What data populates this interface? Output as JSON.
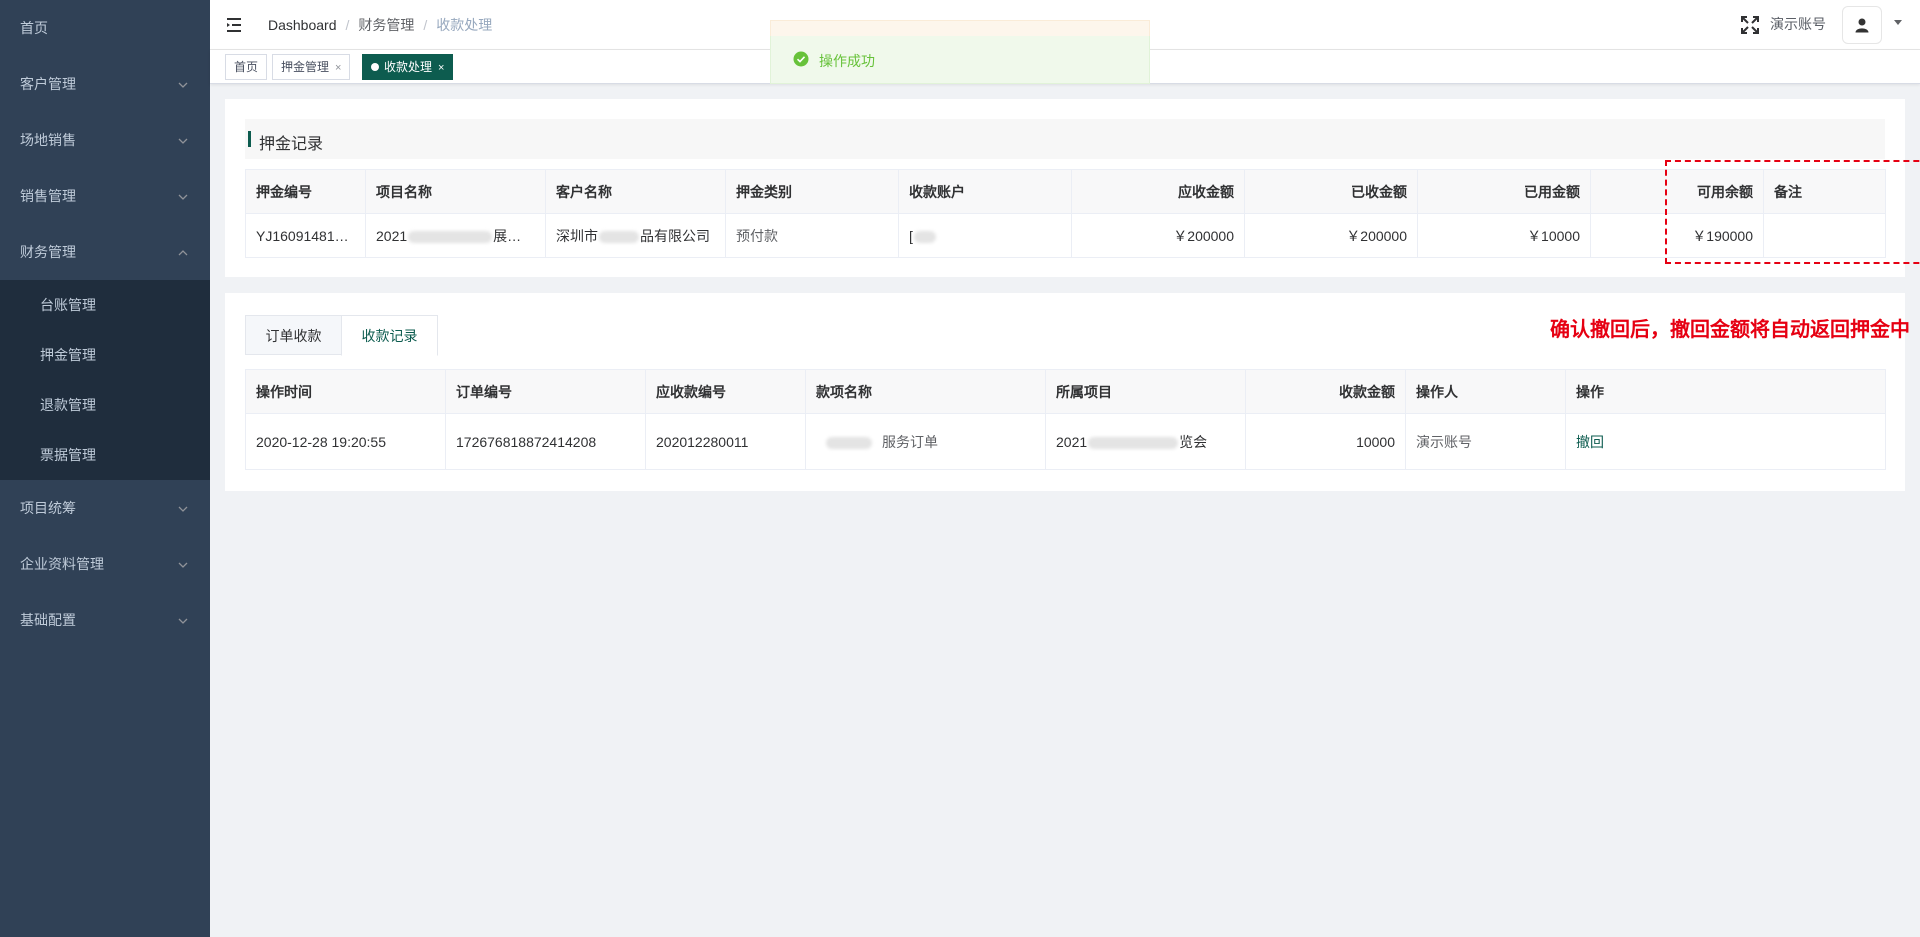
{
  "sidebar": {
    "items": [
      {
        "label": "首页",
        "has_children": false
      },
      {
        "label": "客户管理",
        "has_children": true
      },
      {
        "label": "场地销售",
        "has_children": true
      },
      {
        "label": "销售管理",
        "has_children": true
      },
      {
        "label": "财务管理",
        "has_children": true,
        "expanded": true
      }
    ],
    "finance_children": [
      "台账管理",
      "押金管理",
      "退款管理",
      "票据管理"
    ],
    "items_after": [
      {
        "label": "项目统筹"
      },
      {
        "label": "企业资料管理"
      },
      {
        "label": "基础配置"
      }
    ]
  },
  "navbar": {
    "breadcrumb": [
      "Dashboard",
      "财务管理",
      "收款处理"
    ],
    "username": "演示账号"
  },
  "tags": [
    {
      "label": "首页",
      "closable": false,
      "active": false
    },
    {
      "label": "押金管理",
      "closable": true,
      "active": false
    },
    {
      "label": "收款处理",
      "closable": true,
      "active": true
    }
  ],
  "toast": {
    "message": "操作成功"
  },
  "deposit": {
    "title": "押金记录",
    "headers": [
      "押金编号",
      "项目名称",
      "客户名称",
      "押金类别",
      "收款账户",
      "应收金额",
      "已收金额",
      "已用金额",
      "可用余额",
      "备注"
    ],
    "row": {
      "deposit_no": "YJ16091481…",
      "project_prefix": "2021",
      "project_suffix": "展览会",
      "customer_prefix": "深圳市",
      "customer_suffix": "品有限公司",
      "category": "预付款",
      "account_prefix": "[",
      "receivable": "￥200000",
      "received": "￥200000",
      "used": "￥10000",
      "balance": "￥190000",
      "remark": ""
    }
  },
  "records": {
    "tabs": [
      "订单收款",
      "收款记录"
    ],
    "active_tab": 1,
    "headers": [
      "操作时间",
      "订单编号",
      "应收款编号",
      "款项名称",
      "所属项目",
      "收款金额",
      "操作人",
      "操作"
    ],
    "row": {
      "time": "2020-12-28 19:20:55",
      "order_no": "172676818872414208",
      "receivable_no": "202012280011",
      "item_name_suffix": "服务订单",
      "project_prefix": "2021",
      "project_suffix": "览会",
      "amount": "10000",
      "operator": "演示账号",
      "action": "撤回"
    }
  },
  "annotation": {
    "text": "确认撤回后，撤回金额将自动返回押金中"
  },
  "colors": {
    "sidebar": "#304156",
    "accent": "#0d5c4f",
    "annotation": "#e60012",
    "success": "#67c23a"
  }
}
